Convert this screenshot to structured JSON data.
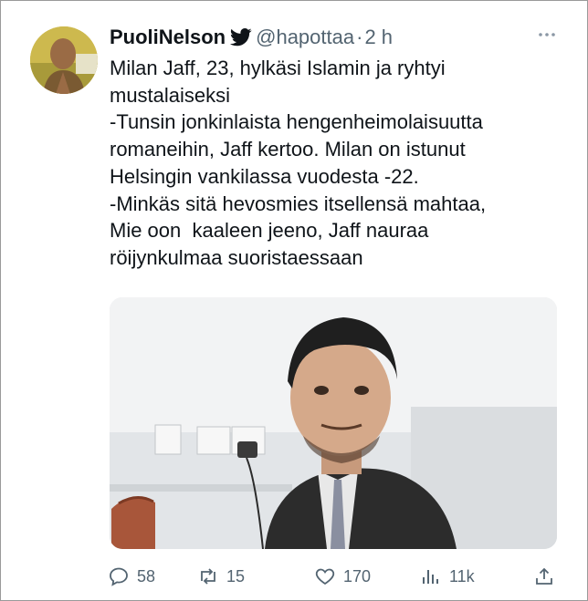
{
  "tweet": {
    "display_name": "PuoliNelson",
    "handle": "@hapottaa",
    "separator": "·",
    "time": "2 h",
    "text_lines": [
      "Milan Jaff, 23, hylkäsi Islamin ja ryhtyi",
      "mustalaiseksi",
      "-Tunsin jonkinlaista hengenheimolaisuutta",
      "romaneihin, Jaff kertoo. Milan on istunut",
      "Helsingin vankilassa vuodesta -22.",
      "-Minkäs sitä hevosmies itsellensä mahtaa,",
      "Mie oon  kaaleen jeeno, Jaff nauraa",
      "röijynkulmaa suoristaessaan"
    ]
  },
  "icons": {
    "verified": "bird-verified-icon",
    "more": "more-dots-icon",
    "reply": "reply-icon",
    "retweet": "retweet-icon",
    "like": "heart-icon",
    "views": "views-icon",
    "share": "share-icon"
  },
  "actions": {
    "replies": "58",
    "retweets": "15",
    "likes": "170",
    "views": "11k"
  },
  "colors": {
    "text": "#0f1419",
    "muted": "#536471",
    "background": "#ffffff"
  }
}
